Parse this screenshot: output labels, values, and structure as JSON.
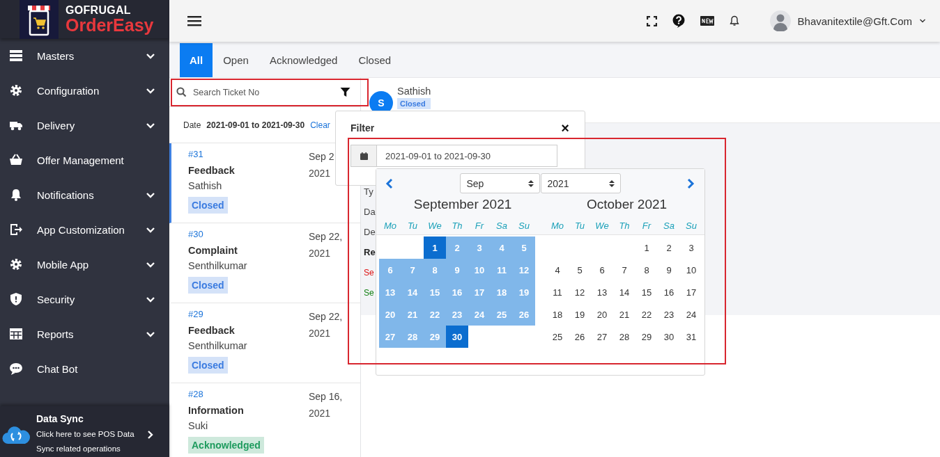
{
  "brand": {
    "top": "GOFRUGAL",
    "bottom": "OrderEasy"
  },
  "sidebar": {
    "items": [
      {
        "label": "Masters",
        "expandable": true
      },
      {
        "label": "Configuration",
        "expandable": true
      },
      {
        "label": "Delivery",
        "expandable": true
      },
      {
        "label": "Offer Management",
        "expandable": false
      },
      {
        "label": "Notifications",
        "expandable": true
      },
      {
        "label": "App Customization",
        "expandable": true
      },
      {
        "label": "Mobile App",
        "expandable": true
      },
      {
        "label": "Security",
        "expandable": true
      },
      {
        "label": "Reports",
        "expandable": true
      },
      {
        "label": "Chat Bot",
        "expandable": false
      }
    ],
    "data_sync": {
      "title": "Data Sync",
      "text": "Click here to see POS Data Sync related operations"
    }
  },
  "header": {
    "user": "Bhavanitextile@Gft.Com"
  },
  "tabs": [
    {
      "label": "All",
      "selected": true
    },
    {
      "label": "Open",
      "selected": false
    },
    {
      "label": "Acknowledged",
      "selected": false
    },
    {
      "label": "Closed",
      "selected": false
    }
  ],
  "search": {
    "placeholder": "Search Ticket No"
  },
  "date_filter": {
    "label": "Date",
    "value": "2021-09-01 to 2021-09-30",
    "clear": "Clear"
  },
  "tickets": [
    {
      "number": "#31",
      "type": "Feedback",
      "name": "Sathish",
      "date": "Sep 2",
      "year": "2021",
      "status": "Closed",
      "color": "#3a7be0",
      "selected": true
    },
    {
      "number": "#30",
      "type": "Complaint",
      "name": "Senthilkumar",
      "date": "Sep 22,",
      "year": "2021",
      "status": "Closed",
      "color": "#3a7be0",
      "selected": false
    },
    {
      "number": "#29",
      "type": "Feedback",
      "name": "Senthilkumar",
      "date": "Sep 22,",
      "year": "2021",
      "status": "Closed",
      "color": "#3a7be0",
      "selected": false
    },
    {
      "number": "#28",
      "type": "Information",
      "name": "Suki",
      "date": "Sep 16,",
      "year": "2021",
      "status": "Acknowledged",
      "color": "#1f9b5e",
      "selected": false
    }
  ],
  "detail": {
    "avatar": "S",
    "name": "Sathish",
    "status": "Closed",
    "fields": [
      {
        "text": "Ty",
        "kind": "plain"
      },
      {
        "text": "Da",
        "kind": "plain"
      },
      {
        "text": "De",
        "kind": "plain"
      },
      {
        "text": "Re",
        "kind": "heading"
      },
      {
        "text": "Se",
        "kind": "error"
      },
      {
        "text": "Se",
        "kind": "success"
      }
    ]
  },
  "filter": {
    "title": "Filter",
    "close": "×",
    "date_value": "2021-09-01 to 2021-09-30"
  },
  "calendar": {
    "month_select": "Sep",
    "year_select": "2021",
    "months": [
      {
        "title": "September 2021",
        "weekdays": [
          "Mo",
          "Tu",
          "We",
          "Th",
          "Fr",
          "Sa",
          "Su"
        ],
        "weeks": [
          [
            {
              "kind": "blank"
            },
            {
              "kind": "blank"
            },
            {
              "kind": "day",
              "day": "1",
              "selected": true,
              "in_range": true
            },
            {
              "kind": "day",
              "day": "2",
              "selected": false,
              "in_range": true
            },
            {
              "kind": "day",
              "day": "3",
              "selected": false,
              "in_range": true
            },
            {
              "kind": "day",
              "day": "4",
              "selected": false,
              "in_range": true
            },
            {
              "kind": "day",
              "day": "5",
              "selected": false,
              "in_range": true
            }
          ],
          [
            {
              "kind": "day",
              "day": "6",
              "selected": false,
              "in_range": true
            },
            {
              "kind": "day",
              "day": "7",
              "selected": false,
              "in_range": true
            },
            {
              "kind": "day",
              "day": "8",
              "selected": false,
              "in_range": true
            },
            {
              "kind": "day",
              "day": "9",
              "selected": false,
              "in_range": true
            },
            {
              "kind": "day",
              "day": "10",
              "selected": false,
              "in_range": true
            },
            {
              "kind": "day",
              "day": "11",
              "selected": false,
              "in_range": true
            },
            {
              "kind": "day",
              "day": "12",
              "selected": false,
              "in_range": true
            }
          ],
          [
            {
              "kind": "day",
              "day": "13",
              "selected": false,
              "in_range": true
            },
            {
              "kind": "day",
              "day": "14",
              "selected": false,
              "in_range": true
            },
            {
              "kind": "day",
              "day": "15",
              "selected": false,
              "in_range": true
            },
            {
              "kind": "day",
              "day": "16",
              "selected": false,
              "in_range": true
            },
            {
              "kind": "day",
              "day": "17",
              "selected": false,
              "in_range": true
            },
            {
              "kind": "day",
              "day": "18",
              "selected": false,
              "in_range": true
            },
            {
              "kind": "day",
              "day": "19",
              "selected": false,
              "in_range": true
            }
          ],
          [
            {
              "kind": "day",
              "day": "20",
              "selected": false,
              "in_range": true
            },
            {
              "kind": "day",
              "day": "21",
              "selected": false,
              "in_range": true
            },
            {
              "kind": "day",
              "day": "22",
              "selected": false,
              "in_range": true
            },
            {
              "kind": "day",
              "day": "23",
              "selected": false,
              "in_range": true
            },
            {
              "kind": "day",
              "day": "24",
              "selected": false,
              "in_range": true
            },
            {
              "kind": "day",
              "day": "25",
              "selected": false,
              "in_range": true
            },
            {
              "kind": "day",
              "day": "26",
              "selected": false,
              "in_range": true
            }
          ],
          [
            {
              "kind": "day",
              "day": "27",
              "selected": false,
              "in_range": true
            },
            {
              "kind": "day",
              "day": "28",
              "selected": false,
              "in_range": true
            },
            {
              "kind": "day",
              "day": "29",
              "selected": false,
              "in_range": true
            },
            {
              "kind": "day",
              "day": "30",
              "selected": true,
              "in_range": true
            }
          ]
        ]
      },
      {
        "title": "October 2021",
        "weekdays": [
          "Mo",
          "Tu",
          "We",
          "Th",
          "Fr",
          "Sa",
          "Su"
        ],
        "weeks": [
          [
            {
              "kind": "blank"
            },
            {
              "kind": "blank"
            },
            {
              "kind": "blank"
            },
            {
              "kind": "blank"
            },
            {
              "kind": "day",
              "day": "1",
              "selected": false,
              "in_range": false
            },
            {
              "kind": "day",
              "day": "2",
              "selected": false,
              "in_range": false
            },
            {
              "kind": "day",
              "day": "3",
              "selected": false,
              "in_range": false
            }
          ],
          [
            {
              "kind": "day",
              "day": "4",
              "selected": false,
              "in_range": false
            },
            {
              "kind": "day",
              "day": "5",
              "selected": false,
              "in_range": false
            },
            {
              "kind": "day",
              "day": "6",
              "selected": false,
              "in_range": false
            },
            {
              "kind": "day",
              "day": "7",
              "selected": false,
              "in_range": false
            },
            {
              "kind": "day",
              "day": "8",
              "selected": false,
              "in_range": false
            },
            {
              "kind": "day",
              "day": "9",
              "selected": false,
              "in_range": false
            },
            {
              "kind": "day",
              "day": "10",
              "selected": false,
              "in_range": false
            }
          ],
          [
            {
              "kind": "day",
              "day": "11",
              "selected": false,
              "in_range": false
            },
            {
              "kind": "day",
              "day": "12",
              "selected": false,
              "in_range": false
            },
            {
              "kind": "day",
              "day": "13",
              "selected": false,
              "in_range": false
            },
            {
              "kind": "day",
              "day": "14",
              "selected": false,
              "in_range": false
            },
            {
              "kind": "day",
              "day": "15",
              "selected": false,
              "in_range": false
            },
            {
              "kind": "day",
              "day": "16",
              "selected": false,
              "in_range": false
            },
            {
              "kind": "day",
              "day": "17",
              "selected": false,
              "in_range": false
            }
          ],
          [
            {
              "kind": "day",
              "day": "18",
              "selected": false,
              "in_range": false
            },
            {
              "kind": "day",
              "day": "19",
              "selected": false,
              "in_range": false
            },
            {
              "kind": "day",
              "day": "20",
              "selected": false,
              "in_range": false
            },
            {
              "kind": "day",
              "day": "21",
              "selected": false,
              "in_range": false
            },
            {
              "kind": "day",
              "day": "22",
              "selected": false,
              "in_range": false
            },
            {
              "kind": "day",
              "day": "23",
              "selected": false,
              "in_range": false
            },
            {
              "kind": "day",
              "day": "24",
              "selected": false,
              "in_range": false
            }
          ],
          [
            {
              "kind": "day",
              "day": "25",
              "selected": false,
              "in_range": false
            },
            {
              "kind": "day",
              "day": "26",
              "selected": false,
              "in_range": false
            },
            {
              "kind": "day",
              "day": "27",
              "selected": false,
              "in_range": false
            },
            {
              "kind": "day",
              "day": "28",
              "selected": false,
              "in_range": false
            },
            {
              "kind": "day",
              "day": "29",
              "selected": false,
              "in_range": false
            },
            {
              "kind": "day",
              "day": "30",
              "selected": false,
              "in_range": false
            },
            {
              "kind": "day",
              "day": "31",
              "selected": false,
              "in_range": false
            }
          ]
        ]
      }
    ]
  }
}
